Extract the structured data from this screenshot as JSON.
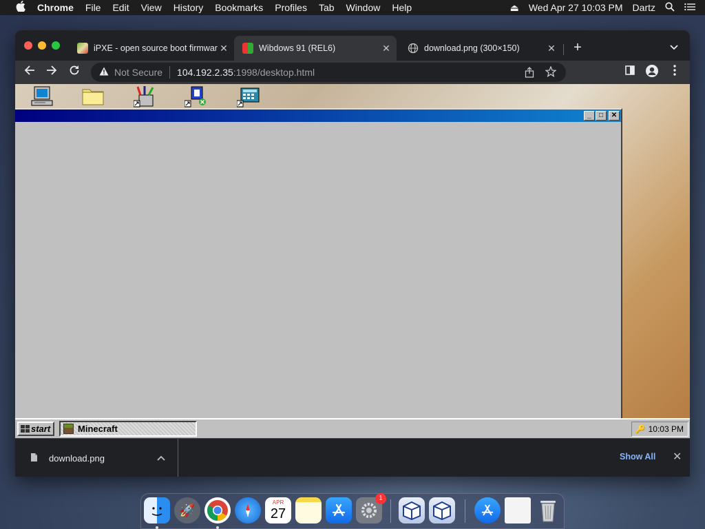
{
  "menubar": {
    "apple": "",
    "items": [
      "Chrome",
      "File",
      "Edit",
      "View",
      "History",
      "Bookmarks",
      "Profiles",
      "Tab",
      "Window",
      "Help"
    ],
    "datetime": "Wed Apr 27  10:03 PM",
    "user": "Dartz"
  },
  "browser": {
    "tabs": [
      {
        "title": "iPXE - open source boot firmware"
      },
      {
        "title": "Wibdows 91 (REL6)"
      },
      {
        "title": "download.png (300×150)"
      }
    ],
    "url": {
      "security": "Not Secure",
      "host": "104.192.2.35",
      "path": ":1998/desktop.html"
    }
  },
  "desktop": {
    "icons": [
      "my-computer-icon",
      "folder-icon",
      "paint-tools-icon",
      "network-icon",
      "calculator-icon"
    ]
  },
  "win98": {
    "window_title": "",
    "start_label": "start",
    "taskbar_item": "Minecraft",
    "clock": "10:03 PM"
  },
  "download": {
    "filename": "download.png",
    "show_all": "Show All"
  },
  "dock": {
    "calendar_month": "APR",
    "calendar_day": "27",
    "badge": "1"
  },
  "colors": {
    "title_gradient_start": "#000080",
    "title_gradient_end": "#1084d0",
    "link_blue": "#8ab4f8"
  }
}
